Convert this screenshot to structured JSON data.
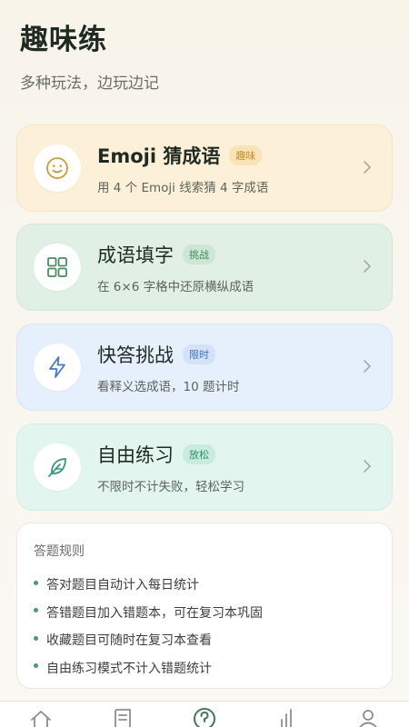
{
  "header": {
    "title": "趣味练",
    "subtitle": "多种玩法，边玩边记"
  },
  "modes": [
    {
      "name": "Emoji 猜成语",
      "badge": "趣味",
      "desc": "用 4 个 Emoji 线索猜 4 字成语",
      "icon": "smiley-icon"
    },
    {
      "name": "成语填字",
      "badge": "挑战",
      "desc": "在 6×6 字格中还原横纵成语",
      "icon": "grid-icon"
    },
    {
      "name": "快答挑战",
      "badge": "限时",
      "desc": "看释义选成语，10 题计时",
      "icon": "lightning-icon"
    },
    {
      "name": "自由练习",
      "badge": "放松",
      "desc": "不限时不计失败，轻松学习",
      "icon": "feather-icon"
    }
  ],
  "rules": {
    "title": "答题规则",
    "items": [
      "答对题目自动计入每日统计",
      "答错题目加入错题本，可在复习本巩固",
      "收藏题目可随时在复习本查看",
      "自由练习模式不计入错题统计"
    ]
  },
  "nav": {
    "items": [
      "home-icon",
      "notebook-icon",
      "quiz-icon",
      "stats-icon",
      "profile-icon"
    ],
    "active": "quiz-icon"
  },
  "colors": {
    "accent": "#3f7a54",
    "emoji_card": "#fdf0d9",
    "fill_card": "#e1f0e5",
    "quick_card": "#e6effc",
    "free_card": "#e2f6ef"
  }
}
